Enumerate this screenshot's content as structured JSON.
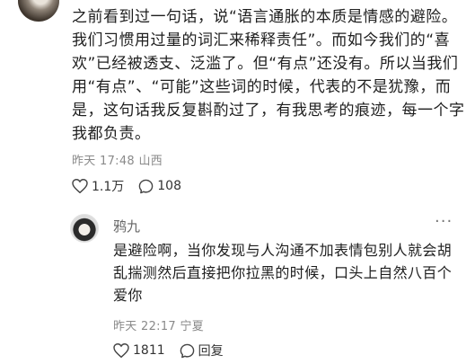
{
  "post": {
    "text": "之前看到过一句话，说“语言通胀的本质是情感的避险。我们习惯用过量的词汇来稀释责任”。而如今我们的“喜欢”已经被透支、泛滥了。但“有点”还没有。所以当我们用“有点”、“可能”这些词的时候，代表的不是犹豫，而是，这句话我反复斟酌过了，有我思考的痕迹，每一个字我都负责。",
    "time": "昨天 17:48",
    "location": "山西",
    "likes": "1.1万",
    "comments": "108"
  },
  "reply": {
    "username": "鸦九",
    "more": "···",
    "text": "是避险啊，当你发现与人沟通不加表情包别人就会胡乱揣测然后直接把你拉黑的时候，口头上自然八百个爱你",
    "time": "昨天 22:17",
    "location": "宁夏",
    "likes": "1811",
    "reply_label": "回复"
  }
}
